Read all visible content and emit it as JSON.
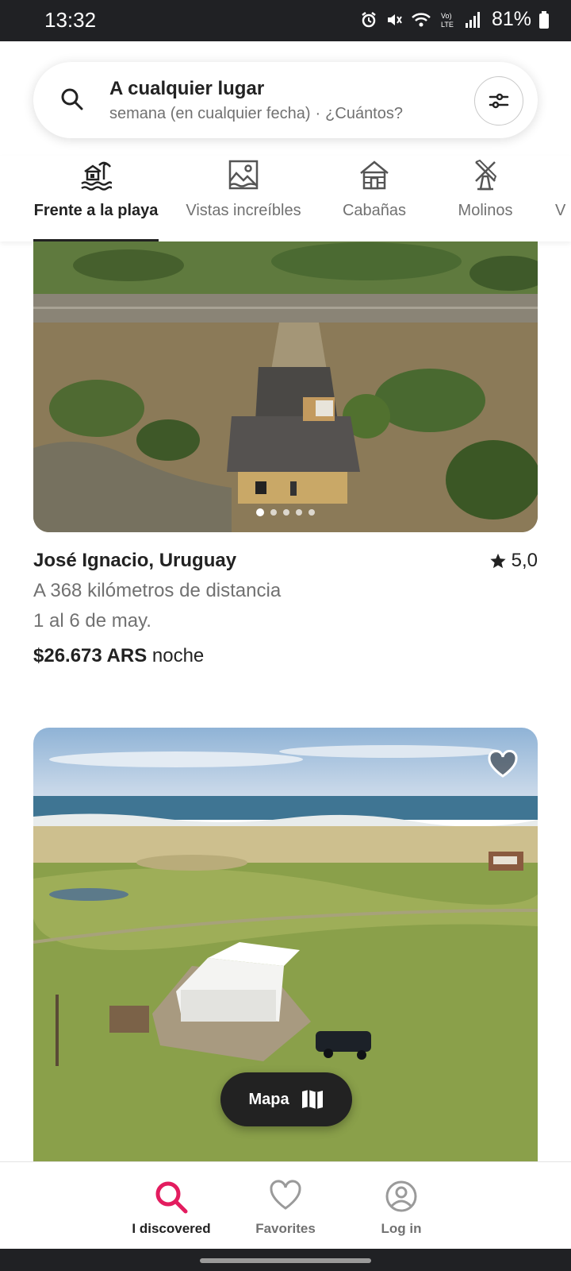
{
  "status_bar": {
    "time": "13:32",
    "battery": "81%",
    "icons": [
      "alarm-icon",
      "mute-icon",
      "wifi-icon",
      "volte-icon",
      "signal-icon",
      "battery-icon"
    ]
  },
  "search": {
    "title": "A cualquier lugar",
    "when": "semana (en cualquier fecha)",
    "separator": "·",
    "guests": "¿Cuántos?"
  },
  "categories": [
    {
      "label": "Frente a la playa",
      "icon": "beach-house-icon",
      "active": true
    },
    {
      "label": "Vistas increíbles",
      "icon": "amazing-views-icon",
      "active": false
    },
    {
      "label": "Cabañas",
      "icon": "cabin-icon",
      "active": false
    },
    {
      "label": "Molinos",
      "icon": "windmill-icon",
      "active": false
    },
    {
      "label": "V",
      "icon": "",
      "active": false
    }
  ],
  "listings": [
    {
      "location": "José Ignacio, Uruguay",
      "rating": "5,0",
      "distance": "A 368 kilómetros de distancia",
      "dates": "1 al 6 de may.",
      "price": "$26.673 ARS",
      "price_unit": "noche",
      "photo_count": 5,
      "photo_index": 1
    },
    {
      "favorite": false
    }
  ],
  "map_button": {
    "label": "Mapa"
  },
  "bottom_nav": [
    {
      "label": "I discovered",
      "icon": "search-icon",
      "active": true
    },
    {
      "label": "Favorites",
      "icon": "heart-icon",
      "active": false
    },
    {
      "label": "Log in",
      "icon": "profile-icon",
      "active": false
    }
  ],
  "colors": {
    "accent": "#E31C5F",
    "text": "#222222",
    "muted": "#717171"
  }
}
